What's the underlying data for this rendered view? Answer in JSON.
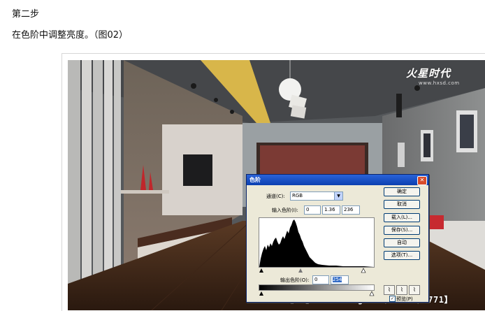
{
  "article": {
    "step_title": "第二步",
    "description": "在色阶中调整亮度。（图02）"
  },
  "photo": {
    "logo_text": "火星时代",
    "logo_url": "www.hxsd.com",
    "watermark": "3Dmax吧 【www.linecg.com/lieba/1771】"
  },
  "dialog": {
    "title": "色阶",
    "close_label": "✕",
    "channel_label": "通道(C):",
    "channel_value": "RGB",
    "input_levels_label": "输入色阶(I):",
    "input_black": "0",
    "input_gamma": "1.36",
    "input_white": "236",
    "output_levels_label": "输出色阶(O):",
    "output_black": "0",
    "output_white": "254",
    "buttons": {
      "ok": "确定",
      "cancel": "取消",
      "load": "载入(L)...",
      "save": "保存(S)...",
      "auto": "自动",
      "options": "选项(T)..."
    },
    "preview_label": "预览(P)",
    "preview_checked": "✓"
  }
}
